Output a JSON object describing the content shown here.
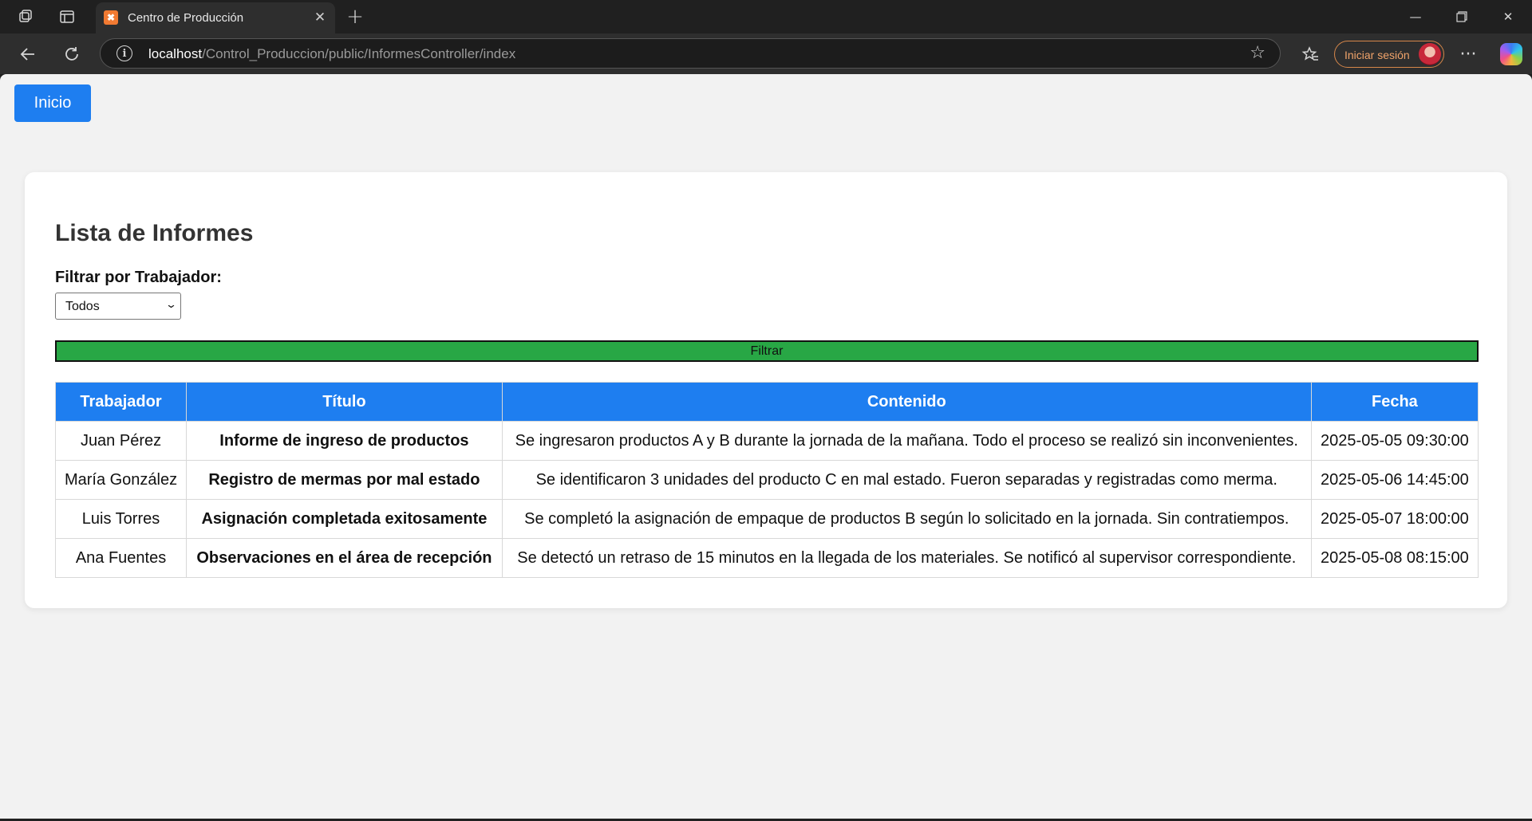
{
  "browser": {
    "tab_title": "Centro de Producción",
    "tab_favicon": "✖",
    "url_host": "localhost",
    "url_path": "/Control_Produccion/public/InformesController/index",
    "signin_label": "Iniciar sesión"
  },
  "page": {
    "home_button": "Inicio",
    "heading": "Lista de Informes",
    "filter_label": "Filtrar por Trabajador:",
    "filter_selected": "Todos",
    "filter_button": "Filtrar"
  },
  "table": {
    "headers": [
      "Trabajador",
      "Título",
      "Contenido",
      "Fecha"
    ],
    "rows": [
      {
        "worker": "Juan Pérez",
        "title": "Informe de ingreso de productos",
        "content": "Se ingresaron productos A y B durante la jornada de la mañana. Todo el proceso se realizó sin inconvenientes.",
        "date": "2025-05-05 09:30:00"
      },
      {
        "worker": "María González",
        "title": "Registro de mermas por mal estado",
        "content": "Se identificaron 3 unidades del producto C en mal estado. Fueron separadas y registradas como merma.",
        "date": "2025-05-06 14:45:00"
      },
      {
        "worker": "Luis Torres",
        "title": "Asignación completada exitosamente",
        "content": "Se completó la asignación de empaque de productos B según lo solicitado en la jornada. Sin contratiempos.",
        "date": "2025-05-07 18:00:00"
      },
      {
        "worker": "Ana Fuentes",
        "title": "Observaciones en el área de recepción",
        "content": "Se detectó un retraso de 15 minutos en la llegada de los materiales. Se notificó al supervisor correspondiente.",
        "date": "2025-05-08 08:15:00"
      }
    ]
  },
  "colors": {
    "primary": "#1e7ef0",
    "filter_button": "#28a745",
    "page_background": "#f2f2f2"
  },
  "icons": {
    "workspaces": "workspaces-icon",
    "tab_actions": "tab-actions-icon",
    "back": "back-arrow-icon",
    "reload": "reload-icon",
    "site_info": "info-icon",
    "favorite": "star-icon",
    "favorites": "favorites-icon",
    "menu": "more-icon",
    "copilot": "copilot-icon"
  }
}
